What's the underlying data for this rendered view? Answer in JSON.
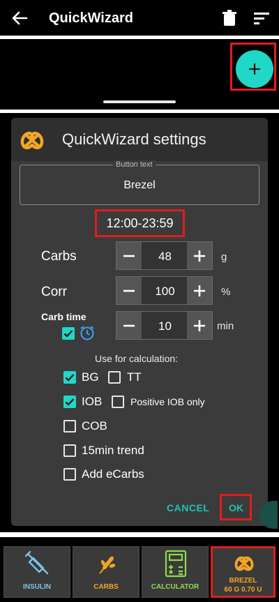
{
  "app_bar": {
    "title": "QuickWizard"
  },
  "dialog": {
    "title": "QuickWizard settings",
    "button_text": {
      "label": "Button text",
      "value": "Brezel"
    },
    "time_range": "12:00-23:59",
    "carbs": {
      "label": "Carbs",
      "value": "48",
      "unit": "g"
    },
    "corr": {
      "label": "Corr",
      "value": "100",
      "unit": "%"
    },
    "carb_time": {
      "label": "Carb time",
      "value": "10",
      "unit": "min",
      "checked": true
    },
    "use_for_calc_label": "Use for calculation:",
    "options": {
      "bg": {
        "label": "BG",
        "checked": true
      },
      "tt": {
        "label": "TT",
        "checked": false
      },
      "iob": {
        "label": "IOB",
        "checked": true
      },
      "positive_iob": {
        "label": "Positive IOB only",
        "checked": false
      },
      "cob": {
        "label": "COB",
        "checked": false
      },
      "trend": {
        "label": "15min trend",
        "checked": false
      },
      "ecarbs": {
        "label": "Add eCarbs",
        "checked": false
      }
    },
    "cancel_label": "CANCEL",
    "ok_label": "OK"
  },
  "bottom_buttons": {
    "insulin": "INSULIN",
    "carbs": "CARBS",
    "calculator": "CALCULATOR",
    "brezel_line1": "BREZEL",
    "brezel_line2": "60 G 0.70 U"
  },
  "colors": {
    "accent": "#1fd8c7",
    "highlight": "#e21d1d",
    "insulin": "#7ec3e6",
    "carbs": "#f2a623",
    "calculator": "#8fdc4b"
  }
}
